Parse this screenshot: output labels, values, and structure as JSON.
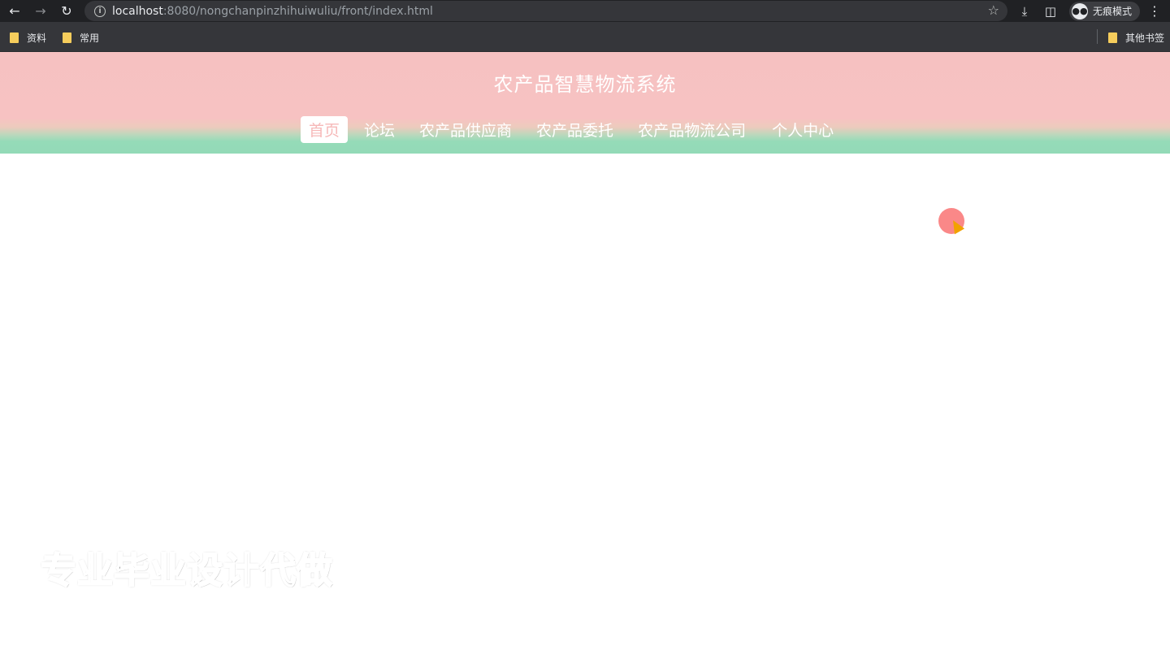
{
  "browser": {
    "url_host": "localhost",
    "url_path": ":8080/nongchanpinzhihuiwuliu/front/index.html",
    "incognito_label": "无痕模式",
    "bookmarks": [
      "资料",
      "常用"
    ],
    "other_bookmarks": "其他书签"
  },
  "site": {
    "title": "农产品智慧物流系统",
    "nav": [
      "首页",
      "论坛",
      "农产品供应商",
      "农产品委托",
      "农产品物流公司",
      "个人中心"
    ],
    "active_nav": "首页"
  },
  "watermark": "专业毕业设计代做",
  "colors": {
    "header_pink": "#f7c2c2",
    "header_green": "#93dab7",
    "active_nav_text": "#f6b8b8"
  }
}
